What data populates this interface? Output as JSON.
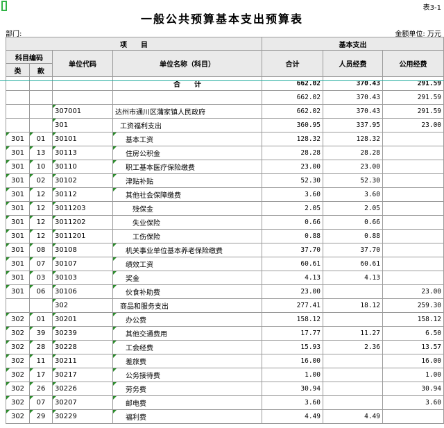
{
  "sheet_no": "表3-1",
  "title": "一般公共预算基本支出预算表",
  "dept_label": "部门:",
  "unit_label": "金额单位: 万元",
  "header": {
    "project": "项　　目",
    "basic_expense": "基本支出",
    "subject_code": "科目编码",
    "category": "类",
    "item": "款",
    "unit_code": "单位代码",
    "unit_name": "单位名称（科目）",
    "total": "合计",
    "personnel": "人员经费",
    "public": "公用经费"
  },
  "total_row": {
    "label": "合　　计",
    "total": "662.02",
    "personnel": "370.43",
    "public": "291.59"
  },
  "rows": [
    {
      "lei": "",
      "kuan": "",
      "code": "",
      "name": "",
      "total": "662.02",
      "personnel": "370.43",
      "public": "291.59"
    },
    {
      "lei": "",
      "kuan": "",
      "code": "307001",
      "name": "达州市通川区蒲家镇人民政府",
      "total": "662.02",
      "personnel": "370.43",
      "public": "291.59"
    },
    {
      "lei": "",
      "kuan": "",
      "code": "301",
      "name": "工资福利支出",
      "total": "360.95",
      "personnel": "337.95",
      "public": "23.00"
    },
    {
      "lei": "301",
      "kuan": "01",
      "code": "30101",
      "name": "基本工资",
      "total": "128.32",
      "personnel": "128.32",
      "public": ""
    },
    {
      "lei": "301",
      "kuan": "13",
      "code": "30113",
      "name": "住房公积金",
      "total": "28.28",
      "personnel": "28.28",
      "public": ""
    },
    {
      "lei": "301",
      "kuan": "10",
      "code": "30110",
      "name": "职工基本医疗保险缴费",
      "total": "23.00",
      "personnel": "23.00",
      "public": ""
    },
    {
      "lei": "301",
      "kuan": "02",
      "code": "30102",
      "name": "津贴补贴",
      "total": "52.30",
      "personnel": "52.30",
      "public": ""
    },
    {
      "lei": "301",
      "kuan": "12",
      "code": "30112",
      "name": "其他社会保障缴费",
      "total": "3.60",
      "personnel": "3.60",
      "public": ""
    },
    {
      "lei": "301",
      "kuan": "12",
      "code": "3011203",
      "name": "残保金",
      "total": "2.05",
      "personnel": "2.05",
      "public": ""
    },
    {
      "lei": "301",
      "kuan": "12",
      "code": "3011202",
      "name": "失业保险",
      "total": "0.66",
      "personnel": "0.66",
      "public": ""
    },
    {
      "lei": "301",
      "kuan": "12",
      "code": "3011201",
      "name": "工伤保险",
      "total": "0.88",
      "personnel": "0.88",
      "public": ""
    },
    {
      "lei": "301",
      "kuan": "08",
      "code": "30108",
      "name": "机关事业单位基本养老保险缴费",
      "total": "37.70",
      "personnel": "37.70",
      "public": ""
    },
    {
      "lei": "301",
      "kuan": "07",
      "code": "30107",
      "name": "绩效工资",
      "total": "60.61",
      "personnel": "60.61",
      "public": ""
    },
    {
      "lei": "301",
      "kuan": "03",
      "code": "30103",
      "name": "奖金",
      "total": "4.13",
      "personnel": "4.13",
      "public": ""
    },
    {
      "lei": "301",
      "kuan": "06",
      "code": "30106",
      "name": "伙食补助费",
      "total": "23.00",
      "personnel": "",
      "public": "23.00"
    },
    {
      "lei": "",
      "kuan": "",
      "code": "302",
      "name": "商品和服务支出",
      "total": "277.41",
      "personnel": "18.12",
      "public": "259.30"
    },
    {
      "lei": "302",
      "kuan": "01",
      "code": "30201",
      "name": "办公费",
      "total": "158.12",
      "personnel": "",
      "public": "158.12"
    },
    {
      "lei": "302",
      "kuan": "39",
      "code": "30239",
      "name": "其他交通费用",
      "total": "17.77",
      "personnel": "11.27",
      "public": "6.50"
    },
    {
      "lei": "302",
      "kuan": "28",
      "code": "30228",
      "name": "工会经费",
      "total": "15.93",
      "personnel": "2.36",
      "public": "13.57"
    },
    {
      "lei": "302",
      "kuan": "11",
      "code": "30211",
      "name": "差旅费",
      "total": "16.00",
      "personnel": "",
      "public": "16.00"
    },
    {
      "lei": "302",
      "kuan": "17",
      "code": "30217",
      "name": "公务接待费",
      "total": "1.00",
      "personnel": "",
      "public": "1.00"
    },
    {
      "lei": "302",
      "kuan": "26",
      "code": "30226",
      "name": "劳务费",
      "total": "30.94",
      "personnel": "",
      "public": "30.94"
    },
    {
      "lei": "302",
      "kuan": "07",
      "code": "30207",
      "name": "邮电费",
      "total": "3.60",
      "personnel": "",
      "public": "3.60"
    },
    {
      "lei": "302",
      "kuan": "29",
      "code": "30229",
      "name": "福利费",
      "total": "4.49",
      "personnel": "4.49",
      "public": ""
    }
  ]
}
